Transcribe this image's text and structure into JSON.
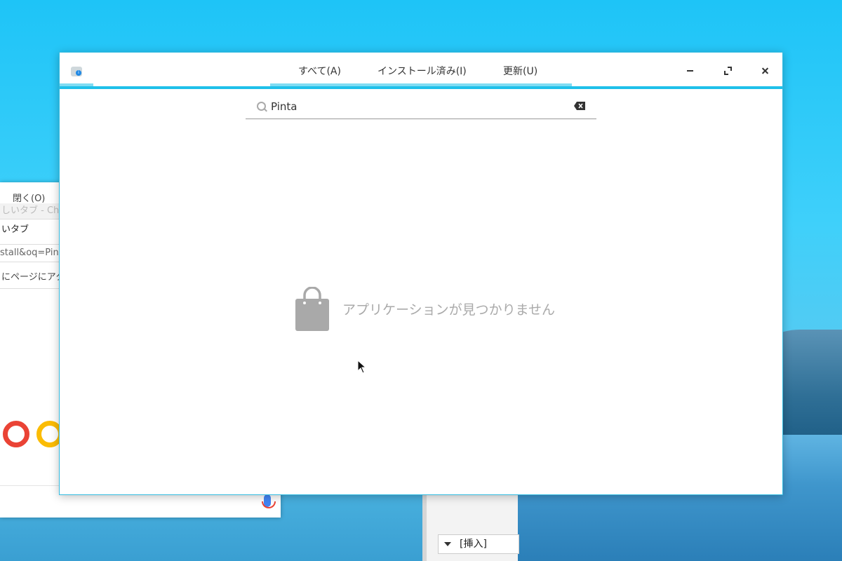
{
  "main_window": {
    "tabs": {
      "all": "すべて(A)",
      "installed": "インストール済み(I)",
      "updates": "更新(U)"
    },
    "search": {
      "value": "Pinta"
    },
    "empty_state": {
      "message": "アプリケーションが見つかりません"
    },
    "icons": {
      "app": "app-store-info-icon",
      "search": "search-icon",
      "clear": "backspace-clear-icon",
      "empty": "shopping-bag-icon",
      "minimize": "minimize-icon",
      "maximize": "maximize-icon",
      "close": "close-icon"
    },
    "accent_color": "#1fc0ea"
  },
  "background_windows": {
    "chrome": {
      "menu_fragment": "閉く(O)",
      "title_fragment": "しいタブ - Chr",
      "tab_fragment": "いタブ",
      "url_fragment": "stall&oq=Pinta",
      "notice_fragment": "にページにアク"
    },
    "editor": {
      "status_mode": "[挿入]"
    }
  }
}
